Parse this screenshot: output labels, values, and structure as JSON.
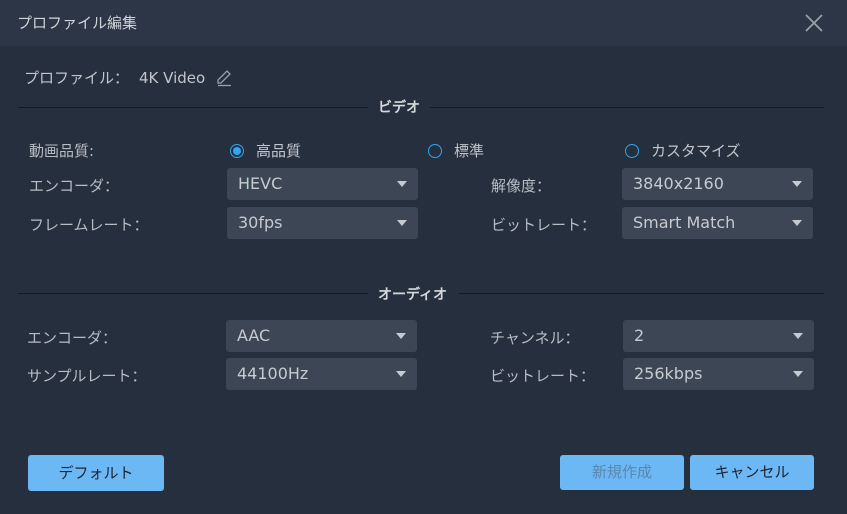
{
  "dialog": {
    "title": "プロファイル編集",
    "close_icon": "close-icon"
  },
  "profile": {
    "label": "プロファイル：",
    "name": "4K Video",
    "edit_icon": "pencil-icon"
  },
  "video": {
    "section_title": "ビデオ",
    "quality_label": "動画品質:",
    "quality_options": [
      {
        "label": "高品質",
        "checked": true
      },
      {
        "label": "標準",
        "checked": false
      },
      {
        "label": "カスタマイズ",
        "checked": false
      }
    ],
    "encoder_label": "エンコーダ：",
    "encoder_value": "HEVC",
    "resolution_label": "解像度：",
    "resolution_value": "3840x2160",
    "framerate_label": "フレームレート：",
    "framerate_value": "30fps",
    "bitrate_label": "ビットレート：",
    "bitrate_value": "Smart Match"
  },
  "audio": {
    "section_title": "オーディオ",
    "encoder_label": "エンコーダ：",
    "encoder_value": "AAC",
    "channel_label": "チャンネル：",
    "channel_value": "2",
    "samplerate_label": "サンプルレート：",
    "samplerate_value": "44100Hz",
    "bitrate_label": "ビットレート：",
    "bitrate_value": "256kbps"
  },
  "buttons": {
    "default_label": "デフォルト",
    "create_label": "新規作成",
    "cancel_label": "キャンセル"
  },
  "colors": {
    "accent": "#2ea6f0",
    "button": "#6cb8f5",
    "background": "#262f3e"
  }
}
